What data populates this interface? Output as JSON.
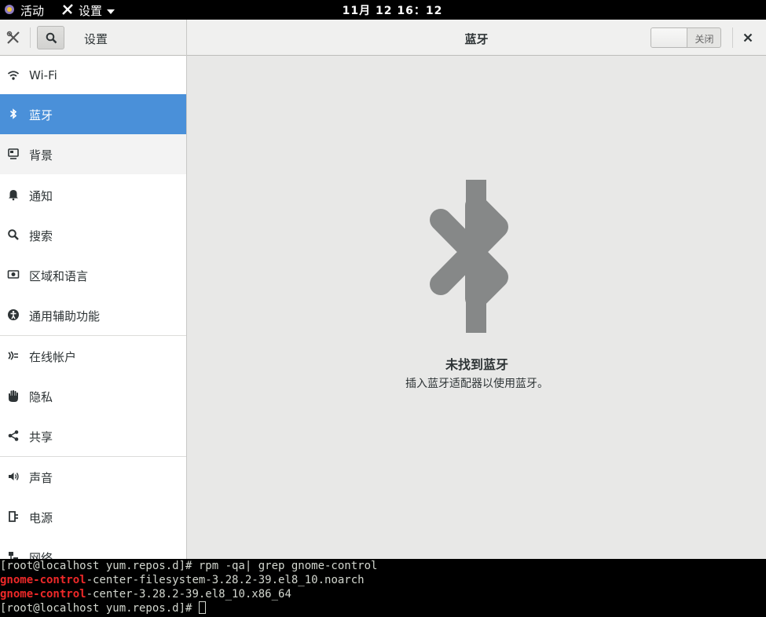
{
  "topbar": {
    "activities_label": "活动",
    "app_label": "设置",
    "clock": "11月 12  16：12"
  },
  "header": {
    "sidebar_title": "设置",
    "page_title": "蓝牙",
    "toggle_label": "关闭",
    "close_label": "×"
  },
  "sidebar": {
    "items": [
      {
        "label": "Wi-Fi",
        "icon": "wifi-icon"
      },
      {
        "label": "蓝牙",
        "icon": "bluetooth-icon"
      },
      {
        "label": "背景",
        "icon": "background-icon"
      },
      {
        "label": "通知",
        "icon": "bell-icon"
      },
      {
        "label": "搜索",
        "icon": "search-icon"
      },
      {
        "label": "区域和语言",
        "icon": "region-icon"
      },
      {
        "label": "通用辅助功能",
        "icon": "accessibility-icon"
      },
      {
        "label": "在线帐户",
        "icon": "online-accounts-icon"
      },
      {
        "label": "隐私",
        "icon": "hand-icon"
      },
      {
        "label": "共享",
        "icon": "share-icon"
      },
      {
        "label": "声音",
        "icon": "speaker-icon"
      },
      {
        "label": "电源",
        "icon": "power-icon"
      },
      {
        "label": "网络",
        "icon": "network-icon"
      }
    ],
    "selected": "蓝牙"
  },
  "content": {
    "empty_title": "未找到蓝牙",
    "empty_subtitle": "插入蓝牙适配器以使用蓝牙。"
  },
  "terminal": {
    "line1": "[root@localhost yum.repos.d]# rpm -qa| grep gnome-control",
    "line2_hl": "gnome-control",
    "line2_rest": "-center-filesystem-3.28.2-39.el8_10.noarch",
    "line3_hl": "gnome-control",
    "line3_rest": "-center-3.28.2-39.el8_10.x86_64",
    "line4": "[root@localhost yum.repos.d]# "
  },
  "colors": {
    "accent": "#4a90d9",
    "terminal_highlight": "#ef2929"
  }
}
